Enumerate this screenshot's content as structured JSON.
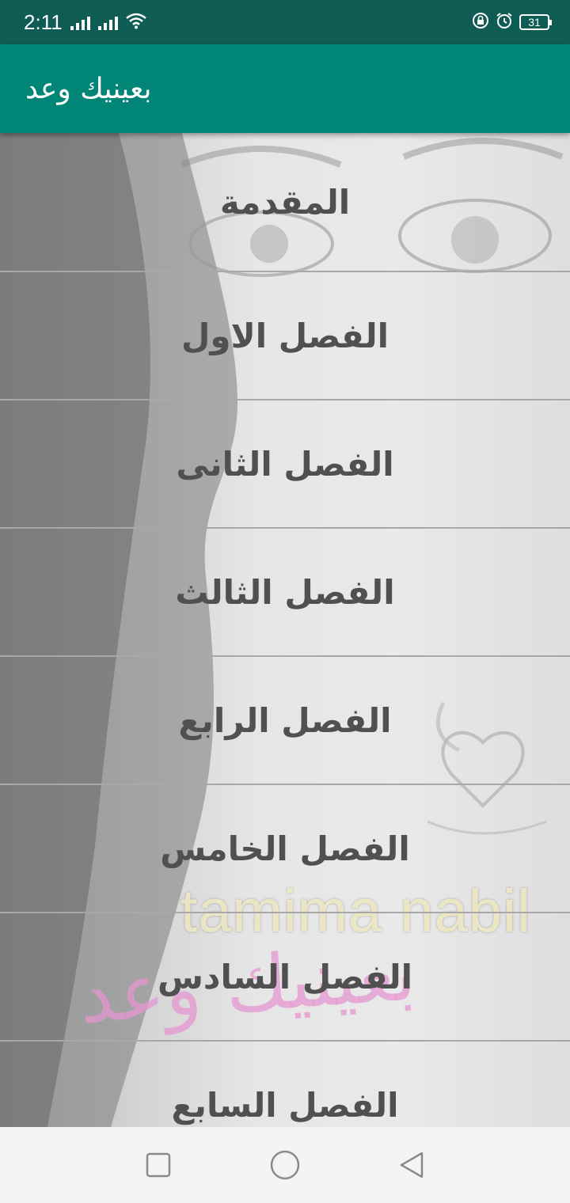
{
  "status_bar": {
    "time": "2:11",
    "battery": "31",
    "icons": [
      "signal-icon",
      "signal-icon",
      "wifi-icon",
      "lock-rotation-icon",
      "alarm-icon",
      "battery-icon"
    ]
  },
  "app_bar": {
    "title": "بعينيك وعد"
  },
  "background": {
    "watermark_latin": "tamima nabil",
    "watermark_arabic": "بعينيك وعد"
  },
  "chapters": [
    {
      "label": "المقدمة"
    },
    {
      "label": "الفصل الاول"
    },
    {
      "label": "الفصل الثانى"
    },
    {
      "label": "الفصل الثالث"
    },
    {
      "label": "الفصل الرابع"
    },
    {
      "label": "الفصل الخامس"
    },
    {
      "label": "الفصل السادس"
    },
    {
      "label": "الفصل السابع"
    }
  ],
  "nav_bar": {
    "icons": [
      "recents-icon",
      "home-icon",
      "back-icon"
    ]
  },
  "colors": {
    "status_bar": "#0f5c55",
    "app_bar": "#008577",
    "chapter_text": "#505050"
  }
}
